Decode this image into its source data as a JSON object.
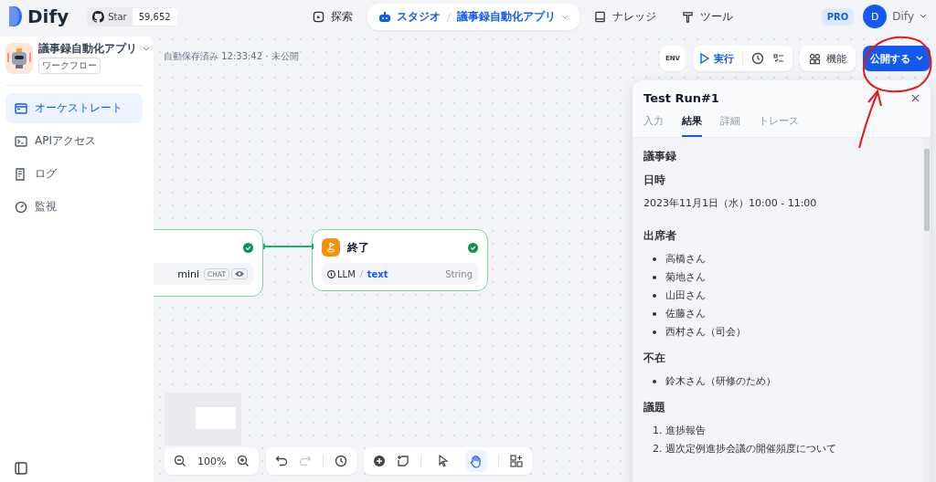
{
  "header": {
    "logo": "Dify",
    "github": {
      "label": "Star",
      "count": "59,652"
    },
    "nav": [
      {
        "kind": "explore",
        "label": "探索",
        "selected": false
      },
      {
        "kind": "studio",
        "label": "スタジオ",
        "app": "議事録自動化アプリ",
        "selected": true
      },
      {
        "kind": "knowledge",
        "label": "ナレッジ",
        "selected": false
      },
      {
        "kind": "tools",
        "label": "ツール",
        "selected": false
      }
    ],
    "plan": "PRO",
    "user": {
      "initial": "D",
      "name": "Dify"
    }
  },
  "sidebar": {
    "app": {
      "name": "議事録自動化アプリ",
      "type": "ワークフロー"
    },
    "items": [
      {
        "kind": "orchestrate",
        "label": "オーケストレート",
        "selected": true
      },
      {
        "kind": "api",
        "label": "APIアクセス",
        "selected": false
      },
      {
        "kind": "logs",
        "label": "ログ",
        "selected": false
      },
      {
        "kind": "monitor",
        "label": "監視",
        "selected": false
      }
    ]
  },
  "canvas": {
    "autosave": "自動保存済み 12:33:42 · 未公開",
    "toolbar": {
      "env": "ENV",
      "run": "実行",
      "features": "機能",
      "publish": "公開する"
    },
    "nodes": [
      {
        "kind": "llm",
        "text": "mini",
        "tag": "CHAT",
        "succeeded": true
      },
      {
        "kind": "end",
        "title": "終了",
        "source": "LLM",
        "variable": "text",
        "type": "String",
        "succeeded": true
      }
    ],
    "zoom": "100%",
    "tools": [
      {
        "kind": "pointer",
        "selected": false
      },
      {
        "kind": "hand",
        "selected": true
      }
    ]
  },
  "run_panel": {
    "title": "Test Run#1",
    "tabs": [
      {
        "label": "入力",
        "selected": false
      },
      {
        "label": "結果",
        "selected": true
      },
      {
        "label": "詳細",
        "selected": false
      },
      {
        "label": "トレース",
        "selected": false
      }
    ],
    "content": [
      {
        "kind": "heading",
        "text": "議事録"
      },
      {
        "kind": "heading",
        "text": "日時"
      },
      {
        "kind": "paragraph",
        "text": "2023年11月1日（水）10:00 - 11:00"
      },
      {
        "kind": "heading",
        "text": "出席者"
      },
      {
        "kind": "bullets",
        "items": [
          "高橋さん",
          "菊地さん",
          "山田さん",
          "佐藤さん",
          "西村さん（司会）"
        ]
      },
      {
        "kind": "heading",
        "text": "不在"
      },
      {
        "kind": "bullets",
        "items": [
          "鈴木さん（研修のため）"
        ]
      },
      {
        "kind": "heading",
        "text": "議題"
      },
      {
        "kind": "numbered",
        "items": [
          {
            "number": "1.",
            "text": "進捗報告"
          },
          {
            "number": "2.",
            "text": "週次定例進捗会議の開催頻度について"
          }
        ]
      }
    ]
  }
}
